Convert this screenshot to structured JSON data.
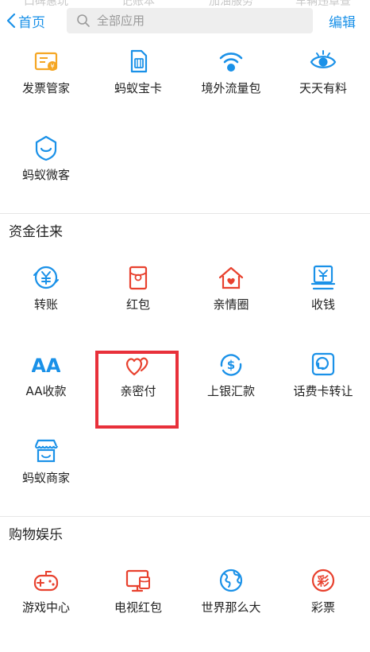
{
  "header": {
    "back_label": "首页",
    "search_placeholder": "全部应用",
    "edit_label": "编辑",
    "scrolled_labels": [
      "口碑惠玩",
      "记账本",
      "加油服务",
      "车辆违章查"
    ]
  },
  "sections": [
    {
      "title": "",
      "rows": [
        [
          {
            "label": "发票管家",
            "icon": "invoice-icon",
            "color": "#f5a623"
          },
          {
            "label": "蚂蚁宝卡",
            "icon": "sim-card-icon",
            "color": "#1a91e8"
          },
          {
            "label": "境外流量包",
            "icon": "wifi-globe-icon",
            "color": "#1a91e8"
          },
          {
            "label": "天天有料",
            "icon": "eye-icon",
            "color": "#1a91e8"
          }
        ],
        [
          {
            "label": "蚂蚁微客",
            "icon": "shield-smile-icon",
            "color": "#1a91e8"
          }
        ]
      ]
    },
    {
      "title": "资金往来",
      "rows": [
        [
          {
            "label": "转账",
            "icon": "yuan-circle-icon",
            "color": "#1a91e8"
          },
          {
            "label": "红包",
            "icon": "red-envelope-icon",
            "color": "#e8412e"
          },
          {
            "label": "亲情圈",
            "icon": "family-house-icon",
            "color": "#e8412e"
          },
          {
            "label": "收钱",
            "icon": "receive-money-icon",
            "color": "#1a91e8"
          }
        ],
        [
          {
            "label": "AA收款",
            "icon": "aa-icon",
            "color": "#1a91e8"
          },
          {
            "label": "亲密付",
            "icon": "double-heart-icon",
            "color": "#e8412e"
          },
          {
            "label": "上银汇款",
            "icon": "dollar-swirl-icon",
            "color": "#1a91e8"
          },
          {
            "label": "话费卡转让",
            "icon": "phone-card-icon",
            "color": "#1a91e8"
          }
        ],
        [
          {
            "label": "蚂蚁商家",
            "icon": "storefront-icon",
            "color": "#1a91e8"
          }
        ]
      ]
    },
    {
      "title": "购物娱乐",
      "rows": [
        [
          {
            "label": "游戏中心",
            "icon": "gamepad-icon",
            "color": "#e8412e"
          },
          {
            "label": "电视红包",
            "icon": "tv-envelope-icon",
            "color": "#e8412e"
          },
          {
            "label": "世界那么大",
            "icon": "globe-icon",
            "color": "#1a91e8"
          },
          {
            "label": "彩票",
            "icon": "lottery-icon",
            "color": "#e8412e"
          }
        ]
      ]
    }
  ],
  "highlight": {
    "target": "亲密付",
    "color": "#e8303a"
  }
}
